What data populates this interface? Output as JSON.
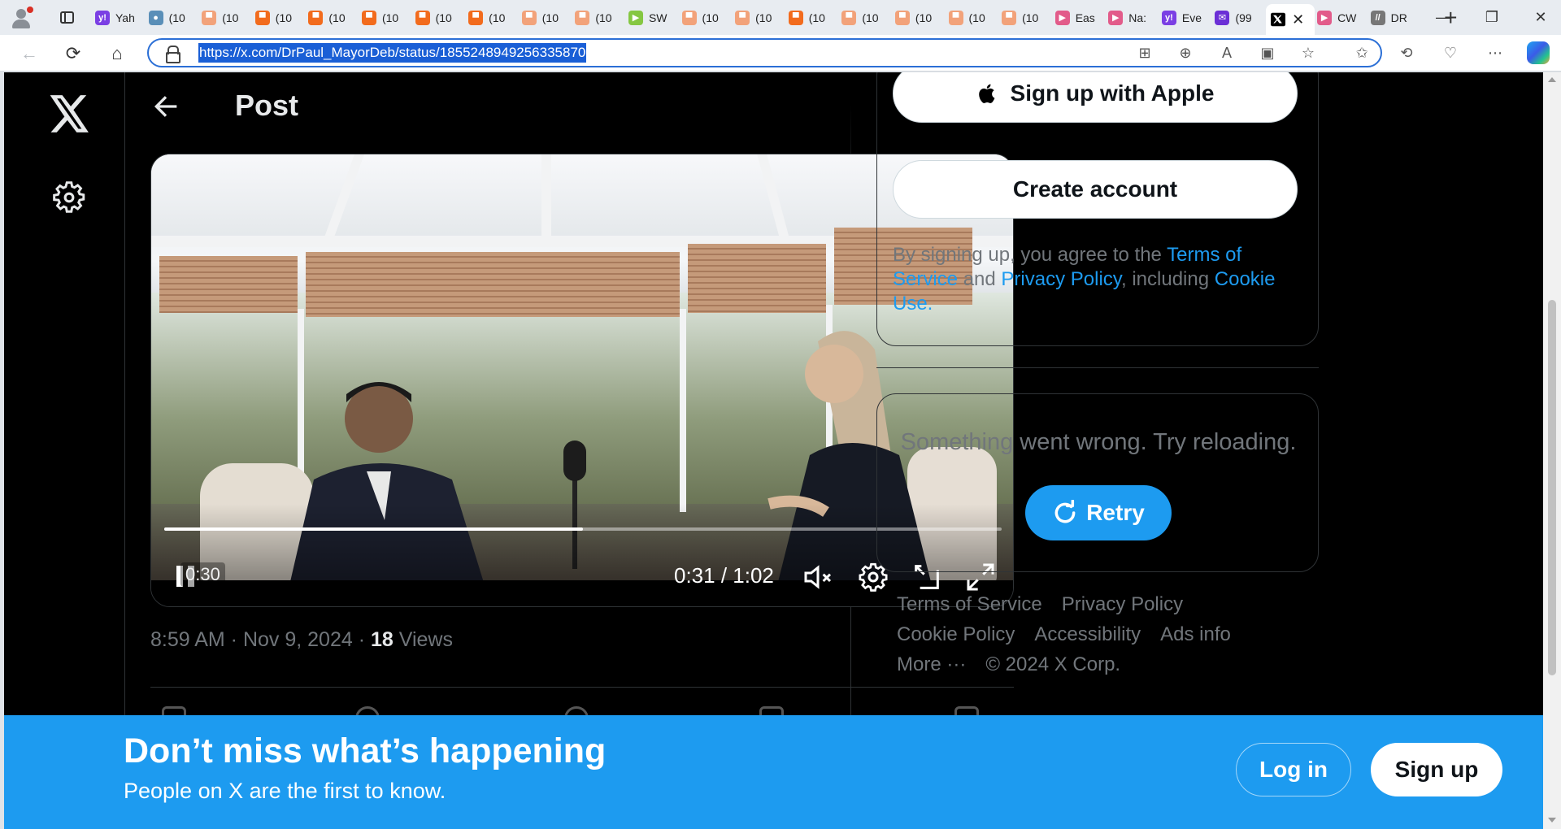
{
  "browser": {
    "tabs": [
      {
        "label": "Yah",
        "icon": "yahoo-icon",
        "color": "#7b3fe4"
      },
      {
        "label": "(10",
        "icon": "globe-icon",
        "color": "#5a8fb8"
      },
      {
        "label": "(10",
        "icon": "substack-icon",
        "color": "#f2a27a"
      },
      {
        "label": "(10",
        "icon": "substack-icon",
        "color": "#f26b1d"
      },
      {
        "label": "(10",
        "icon": "substack-icon",
        "color": "#f26b1d"
      },
      {
        "label": "(10",
        "icon": "substack-icon",
        "color": "#f26b1d"
      },
      {
        "label": "(10",
        "icon": "substack-icon",
        "color": "#f26b1d"
      },
      {
        "label": "(10",
        "icon": "substack-icon",
        "color": "#f26b1d"
      },
      {
        "label": "(10",
        "icon": "substack-icon",
        "color": "#f2a27a"
      },
      {
        "label": "(10",
        "icon": "substack-icon",
        "color": "#f2a27a"
      },
      {
        "label": "SW",
        "icon": "rumble-icon",
        "color": "#85c742"
      },
      {
        "label": "(10",
        "icon": "substack-icon",
        "color": "#f2a27a"
      },
      {
        "label": "(10",
        "icon": "substack-icon",
        "color": "#f2a27a"
      },
      {
        "label": "(10",
        "icon": "substack-icon",
        "color": "#f26b1d"
      },
      {
        "label": "(10",
        "icon": "substack-icon",
        "color": "#f2a27a"
      },
      {
        "label": "(10",
        "icon": "substack-icon",
        "color": "#f2a27a"
      },
      {
        "label": "(10",
        "icon": "substack-icon",
        "color": "#f2a27a"
      },
      {
        "label": "(10",
        "icon": "substack-icon",
        "color": "#f2a27a"
      },
      {
        "label": "Eas",
        "icon": "video-icon",
        "color": "#e25b8a"
      },
      {
        "label": "Na:",
        "icon": "video-icon",
        "color": "#e25b8a"
      },
      {
        "label": "Eve",
        "icon": "yahoo-icon",
        "color": "#7b3fe4"
      },
      {
        "label": "(99",
        "icon": "mail-icon",
        "color": "#6b2fd6"
      }
    ],
    "active_tab": {
      "icon": "x-logo-icon"
    },
    "trailing_tabs": [
      {
        "label": "CW",
        "icon": "video-icon",
        "color": "#e25b8a"
      },
      {
        "label": "DR",
        "icon": "slash-icon",
        "color": "#777777"
      }
    ],
    "url": "https://x.com/DrPaul_MayorDeb/status/1855248949256335870"
  },
  "header": {
    "title": "Post"
  },
  "video": {
    "preview_time": "0:30",
    "time": "0:31 / 1:02",
    "progress": 0.5
  },
  "post": {
    "time_date": "8:59 AM · Nov 9, 2024 · ",
    "views_count": "18",
    "views_label": " Views"
  },
  "signup": {
    "apple_label": "Sign up with Apple",
    "create_label": "Create account",
    "legal_prefix": "By signing up, you agree to the ",
    "terms": "Terms of Service",
    "and": " and ",
    "privacy": "Privacy Policy",
    "including": ", including ",
    "cookie": "Cookie Use.",
    "accent": "#1d9bf0"
  },
  "error_card": {
    "message": "Something went wrong. Try reloading.",
    "retry_label": "Retry"
  },
  "footer": {
    "terms": "Terms of Service",
    "privacy": "Privacy Policy",
    "cookie": "Cookie Policy",
    "accessibility": "Accessibility",
    "ads": "Ads info",
    "more": "More ···",
    "copyright": "© 2024 X Corp."
  },
  "banner": {
    "title": "Don’t miss what’s happening",
    "subtitle": "People on X are the first to know.",
    "login": "Log in",
    "signup": "Sign up",
    "color": "#1d9bf0"
  }
}
